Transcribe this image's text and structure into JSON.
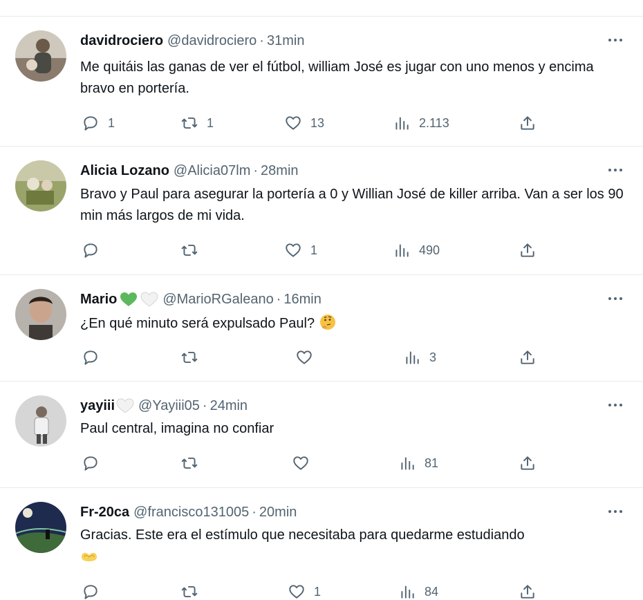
{
  "tweets": [
    {
      "name": "davidrociero",
      "handle": "@davidrociero",
      "time": "31min",
      "text": "Me quitáis las ganas de ver el fútbol, william José es jugar con uno menos y encima bravo en portería.",
      "replies": "1",
      "retweets": "1",
      "likes": "13",
      "views": "2.113",
      "avatar_color": "#8a7b6d"
    },
    {
      "name": "Alicia Lozano",
      "handle": "@Alicia07lm",
      "time": "28min",
      "text": "Bravo y Paul para asegurar la portería a 0 y Willian José de killer arriba. Van a ser los 90 min más largos de mi vida.",
      "replies": "",
      "retweets": "",
      "likes": "1",
      "views": "490",
      "avatar_color": "#7a8a4e"
    },
    {
      "name": "Mario",
      "name_emoji": [
        "green-heart",
        "white-heart"
      ],
      "handle": "@MarioRGaleano",
      "time": "16min",
      "text": "¿En qué minuto será expulsado Paul?",
      "text_emoji": "thinking-face",
      "replies": "",
      "retweets": "",
      "likes": "",
      "views": "3",
      "avatar_color": "#5d4a40"
    },
    {
      "name": "yayiii",
      "name_emoji": [
        "white-heart"
      ],
      "handle": "@Yayiii05",
      "time": "24min",
      "text": "Paul central, imagina no confiar",
      "replies": "",
      "retweets": "",
      "likes": "",
      "views": "81",
      "avatar_color": "#c9c9c9"
    },
    {
      "name": "Fr-20ca",
      "handle": "@francisco131005",
      "time": "20min",
      "text": "Gracias. Este era el estímulo que necesitaba para quedarme estudiando",
      "text_emoji": "heart-hands",
      "replies": "",
      "retweets": "",
      "likes": "1",
      "views": "84",
      "avatar_color": "#2d3e6e"
    }
  ],
  "colors": {
    "text_primary": "#0f1419",
    "text_secondary": "#536471",
    "divider": "#e6e9eb",
    "green_heart": "#5cb85c"
  },
  "icons": {
    "reply": "speech-bubble-icon",
    "retweet": "retweet-arrows-icon",
    "like": "heart-outline-icon",
    "views": "bar-chart-icon",
    "share": "upload-arrow-icon",
    "more": "ellipsis-icon"
  }
}
